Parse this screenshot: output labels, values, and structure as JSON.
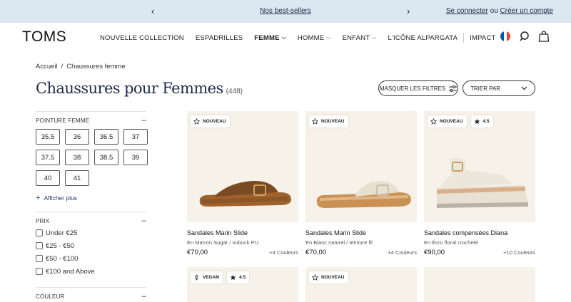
{
  "promo": {
    "prev": "‹",
    "next": "›",
    "message": "Nos best-sellers",
    "login": "Se connecter",
    "or": "ou",
    "create": "Créer un compte"
  },
  "header": {
    "logo": "TOMS",
    "nav": [
      {
        "label": "NOUVELLE COLLECTION"
      },
      {
        "label": "ESPADRILLES"
      },
      {
        "label": "FEMME"
      },
      {
        "label": "HOMME"
      },
      {
        "label": "ENFANT"
      },
      {
        "label": "L'ICÔNE ALPARGATA"
      },
      {
        "label": "IMPACT"
      }
    ],
    "chevron": "⌵",
    "flag_colors": [
      "#0055a4",
      "#ffffff",
      "#ef4135"
    ]
  },
  "breadcrumb": {
    "home": "Accueil",
    "sep": "/",
    "current": "Chaussures femme"
  },
  "title": "Chaussures pour Femmes",
  "count": "(448)",
  "toolbar": {
    "filters": "MASQUER LES FILTRES",
    "sort": "TRIER PAR"
  },
  "sidebar": {
    "size_title": "POINTURE FEMME",
    "collapse": "–",
    "sizes": [
      "35.5",
      "36",
      "36.5",
      "37",
      "37.5",
      "38",
      "38.5",
      "39",
      "40",
      "41"
    ],
    "more": "Afficher plus",
    "more_icon": "+",
    "price_title": "PRIX",
    "prices": [
      "Under €25",
      "€25 - €50",
      "€50 - €100",
      "€100 and Above"
    ],
    "color_title": "COULEUR"
  },
  "products": [
    {
      "badge": "NOUVEAU",
      "rating": "",
      "name": "Sandales Marin Slide",
      "variant": "En Marron Sugar / nubuck PU",
      "price": "€70,00",
      "colors": "+4 Couleurs",
      "strap": "#7a4a23",
      "sole": "#a0622d",
      "top": "#8b5a2e"
    },
    {
      "badge": "NOUVEAU",
      "rating": "",
      "name": "Sandales Marin Slide",
      "variant": "En Blanc naturel / teinture fil",
      "price": "€70,00",
      "colors": "+4 Couleurs",
      "strap": "#e7e0cf",
      "sole": "#c99154",
      "top": "#e0b885"
    },
    {
      "badge": "NOUVEAU",
      "rating": "4.5",
      "name": "Sandales compensées Diana",
      "variant": "En Écru floral crocheté",
      "price": "€90,00",
      "colors": "+10 Couleurs",
      "strap": "#ece7db",
      "sole": "#d8d0c2",
      "top": "#d9b08a"
    },
    {
      "badge": "VEGAN",
      "rating": "4.5"
    },
    {
      "badge": "NOUVEAU",
      "rating": ""
    },
    {
      "badge": "",
      "rating": ""
    }
  ]
}
